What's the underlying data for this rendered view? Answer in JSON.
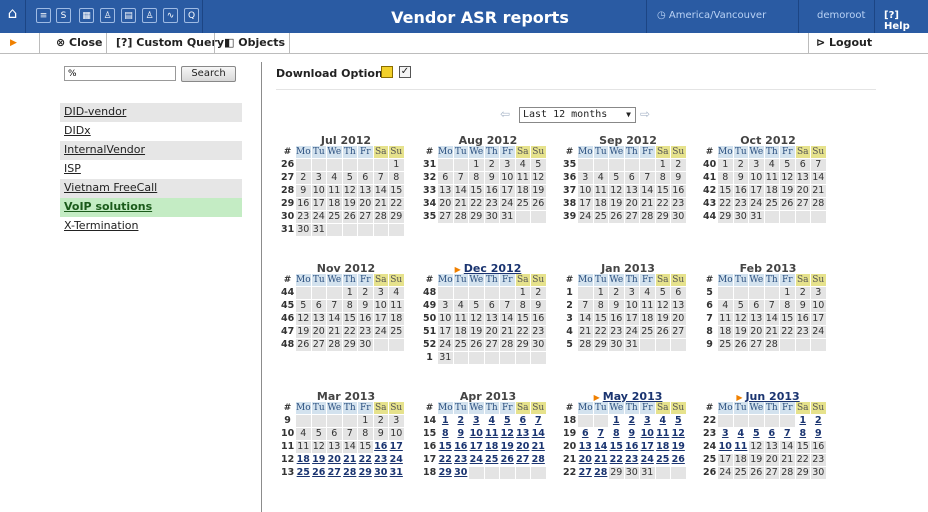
{
  "header": {
    "title": "Vendor ASR reports",
    "timezone": "America/Vancouver",
    "user": "demoroot",
    "help": "Help",
    "icons": [
      "home-icon",
      "list-icon",
      "s-icon",
      "grid-icon",
      "figure-icon",
      "table-icon",
      "figure2-icon",
      "chart-icon",
      "q-icon"
    ]
  },
  "toolbar": {
    "close": "Close",
    "custom_query": "Custom Query",
    "objects": "Objects",
    "logout": "Logout"
  },
  "search": {
    "value": "%",
    "button": "Search"
  },
  "vendors": [
    "DID-vendor",
    "DIDx",
    "InternalVendor",
    "ISP",
    "Vietnam FreeCall",
    "VoIP solutions",
    "X-Termination"
  ],
  "selected_vendor": "VoIP solutions",
  "download_options": {
    "label": "Download Options",
    "checked": true
  },
  "period": {
    "selected": "Last 12 months"
  },
  "calendar": {
    "header": [
      "#",
      "Mo",
      "Tu",
      "We",
      "Th",
      "Fr",
      "Sa",
      "Su"
    ],
    "months": [
      {
        "title": "Jul 2012",
        "reported": false,
        "first_week": 26,
        "lead": 6,
        "days": 31,
        "report_days": []
      },
      {
        "title": "Aug 2012",
        "reported": false,
        "first_week": 31,
        "lead": 2,
        "days": 31,
        "report_days": []
      },
      {
        "title": "Sep 2012",
        "reported": false,
        "first_week": 35,
        "lead": 5,
        "days": 30,
        "report_days": []
      },
      {
        "title": "Oct 2012",
        "reported": false,
        "first_week": 40,
        "lead": 0,
        "days": 31,
        "report_days": []
      },
      {
        "title": "Nov 2012",
        "reported": false,
        "first_week": 44,
        "lead": 3,
        "days": 30,
        "report_days": []
      },
      {
        "title": "Dec 2012",
        "reported": true,
        "first_week": 48,
        "lead": 5,
        "days": 31,
        "report_days": []
      },
      {
        "title": "Jan 2013",
        "reported": false,
        "first_week": 1,
        "lead": 1,
        "days": 31,
        "report_days": []
      },
      {
        "title": "Feb 2013",
        "reported": false,
        "first_week": 5,
        "lead": 4,
        "days": 28,
        "report_days": []
      },
      {
        "title": "Mar 2013",
        "reported": false,
        "first_week": 9,
        "lead": 4,
        "days": 31,
        "report_days": [
          16,
          17,
          18,
          19,
          20,
          21,
          22,
          23,
          24,
          25,
          26,
          27,
          28,
          29,
          30,
          31
        ]
      },
      {
        "title": "Apr 2013",
        "reported": false,
        "first_week": 14,
        "lead": 0,
        "days": 30,
        "report_days": [
          1,
          2,
          3,
          4,
          5,
          6,
          7,
          8,
          9,
          10,
          11,
          12,
          13,
          14,
          15,
          16,
          17,
          18,
          19,
          20,
          21,
          22,
          23,
          24,
          25,
          26,
          27,
          28,
          29,
          30
        ]
      },
      {
        "title": "May 2013",
        "reported": true,
        "first_week": 18,
        "lead": 2,
        "days": 31,
        "report_days": [
          1,
          2,
          3,
          4,
          5,
          6,
          7,
          8,
          9,
          10,
          11,
          12,
          13,
          14,
          15,
          16,
          17,
          18,
          19,
          20,
          21,
          22,
          23,
          24,
          25,
          26,
          27,
          28
        ]
      },
      {
        "title": "Jun 2013",
        "reported": true,
        "first_week": 22,
        "lead": 5,
        "days": 30,
        "report_days": [
          1,
          2,
          3,
          4,
          5,
          6,
          7,
          8,
          9,
          10,
          11
        ]
      }
    ]
  }
}
